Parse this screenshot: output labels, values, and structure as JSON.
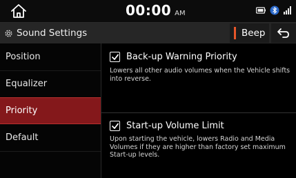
{
  "status_bar": {
    "time": "00:00",
    "ampm": "AM",
    "icons": [
      "home-icon",
      "phone-projection-icon",
      "bluetooth-icon",
      "signal-icon"
    ]
  },
  "header": {
    "title": "Sound Settings",
    "title_icon": "gear-icon",
    "beep_label": "Beep",
    "beep_indicator_color": "#e8562a",
    "back_icon": "back-arrow-icon"
  },
  "sidebar": {
    "items": [
      {
        "label": "Position",
        "active": false
      },
      {
        "label": "Equalizer",
        "active": false
      },
      {
        "label": "Priority",
        "active": true
      },
      {
        "label": "Default",
        "active": false
      }
    ],
    "active_color": "#84181b"
  },
  "content": {
    "options": [
      {
        "label": "Back-up Warning Priority",
        "checked": true,
        "description": "Lowers all other audio volumes when the Vehicle shifts into reverse."
      },
      {
        "label": "Start-up Volume Limit",
        "checked": true,
        "description": "Upon starting the vehicle, lowers Radio and Media Volumes if they are higher than factory set maximum Start-up levels."
      }
    ]
  }
}
